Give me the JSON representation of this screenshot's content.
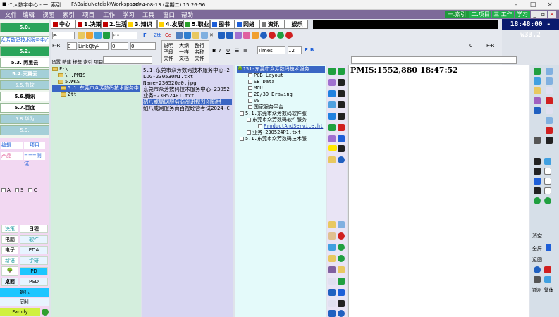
{
  "title": {
    "app": "个人数字中心 - 一. 索引",
    "path": "F:\\BaiduNetdisk\\Workspace\\",
    "datetime": "2024-08-13 (星期二)   15:26:56"
  },
  "menu": [
    "文件",
    "编辑",
    "视图",
    "索引",
    "项目",
    "工作",
    "学习",
    "工具",
    "窗口",
    "帮助"
  ],
  "menu_tabs": [
    "一.索引",
    "二.项目",
    "三.工作",
    "学习"
  ],
  "categories": [
    {
      "label": "中心",
      "color": "#c00000"
    },
    {
      "label": "1.决策",
      "color": "#c00000"
    },
    {
      "label": "2.生活",
      "color": "#c00000"
    },
    {
      "label": "3.知识",
      "color": "#ffd200"
    },
    {
      "label": "4.发展",
      "color": "#ffd200"
    },
    {
      "label": "5.职业",
      "color": "#2aa02a"
    },
    {
      "label": "图书",
      "color": "#1e5fd8"
    },
    {
      "label": "网络",
      "color": "#1e5fd8"
    },
    {
      "label": "资讯",
      "color": "#777777"
    },
    {
      "label": "娱乐",
      "color": ""
    }
  ],
  "clock": "18:48:00 -w33.2",
  "left_nav": {
    "top": "5.0.",
    "company": "众芳数码技术服务中心",
    "items": [
      "5.2.",
      "5.3. 阿里云",
      "5.4.天翼云",
      "5.5.曲软",
      "5.6.腾讯",
      "5.7.百度",
      "5.8.华为",
      "5.9."
    ],
    "links": [
      "编辑",
      "项目",
      "产品",
      "===测试"
    ],
    "radios": [
      "A",
      "S",
      "C"
    ],
    "grid": [
      [
        "决策",
        "日程"
      ],
      [
        "电脑",
        "软件"
      ],
      [
        "电子",
        "EDA"
      ],
      [
        "新语",
        "学研"
      ],
      [
        "",
        "PD"
      ],
      [
        "桌面",
        "PSD"
      ]
    ],
    "bottom": [
      "娱乐",
      "同址",
      "Family"
    ]
  },
  "toolbar": {
    "drive": "E:",
    "filter": "*.*",
    "f_btn": "F",
    "ztt": "Ztt",
    "cd": "Cd",
    "f_r": "F-R",
    "link_qty": "LinkQty",
    "zero1": "0",
    "zero2": "0",
    "zero3": "0",
    "zero4": "0",
    "zero5": "0",
    "f_r2": "F-R",
    "b_btn": "B",
    "f_btn2": "F",
    "opts": [
      "说明",
      "大纲",
      "整行",
      "子段",
      "一样",
      "名称",
      "文件",
      "文档",
      "文件"
    ],
    "font": "Times",
    "font_size": "12",
    "sub_tabs": [
      "设置",
      "新建",
      "标签",
      "索引",
      "项目"
    ]
  },
  "tree": {
    "lines": [
      "F:\\",
      "\\~.PMIS",
      "5.WKS",
      "5.1.东莞市众芳数码技术服务中",
      "Ztt"
    ]
  },
  "file_list": [
    "5.1.东莞市众芳数码技术服务中心-2",
    "LOG-230530M1.txt",
    "Name-230520a0.jpg",
    "东莞市众芳数码技术服务中心-23052",
    "业务-230524P1.txt",
    "绍八戒局网服务商资讯规划创新拼",
    "绍八戒网服务商首视经营考试2024-C"
  ],
  "proj_tree": [
    "151-东莞市众芳数码技术服务",
    "PCB Layout",
    "SB Data",
    "MCU",
    "2D/3D Drawing",
    "VS",
    "国家服务平台",
    "5.1.东莞市众芳数码软件服",
    "东莞市众芳数码软件服务",
    "ProductAndService.ht",
    "业务-230524P1.txt",
    "5.1.东莞市众芳数码技术服"
  ],
  "pmis": "PMIS:1552,880  18:47:52",
  "right_panel": {
    "labels": [
      "消空",
      "全屏",
      "运图",
      "阅读",
      "繁体"
    ]
  },
  "colors": {
    "menubar": "#7d6a99",
    "left_bg": "#f2d8f2",
    "tree_bg": "#d4eedd",
    "list_bg": "#d8d6f2",
    "proj_bg": "#e4fafa",
    "clock_bg": "#0a1a6e"
  }
}
